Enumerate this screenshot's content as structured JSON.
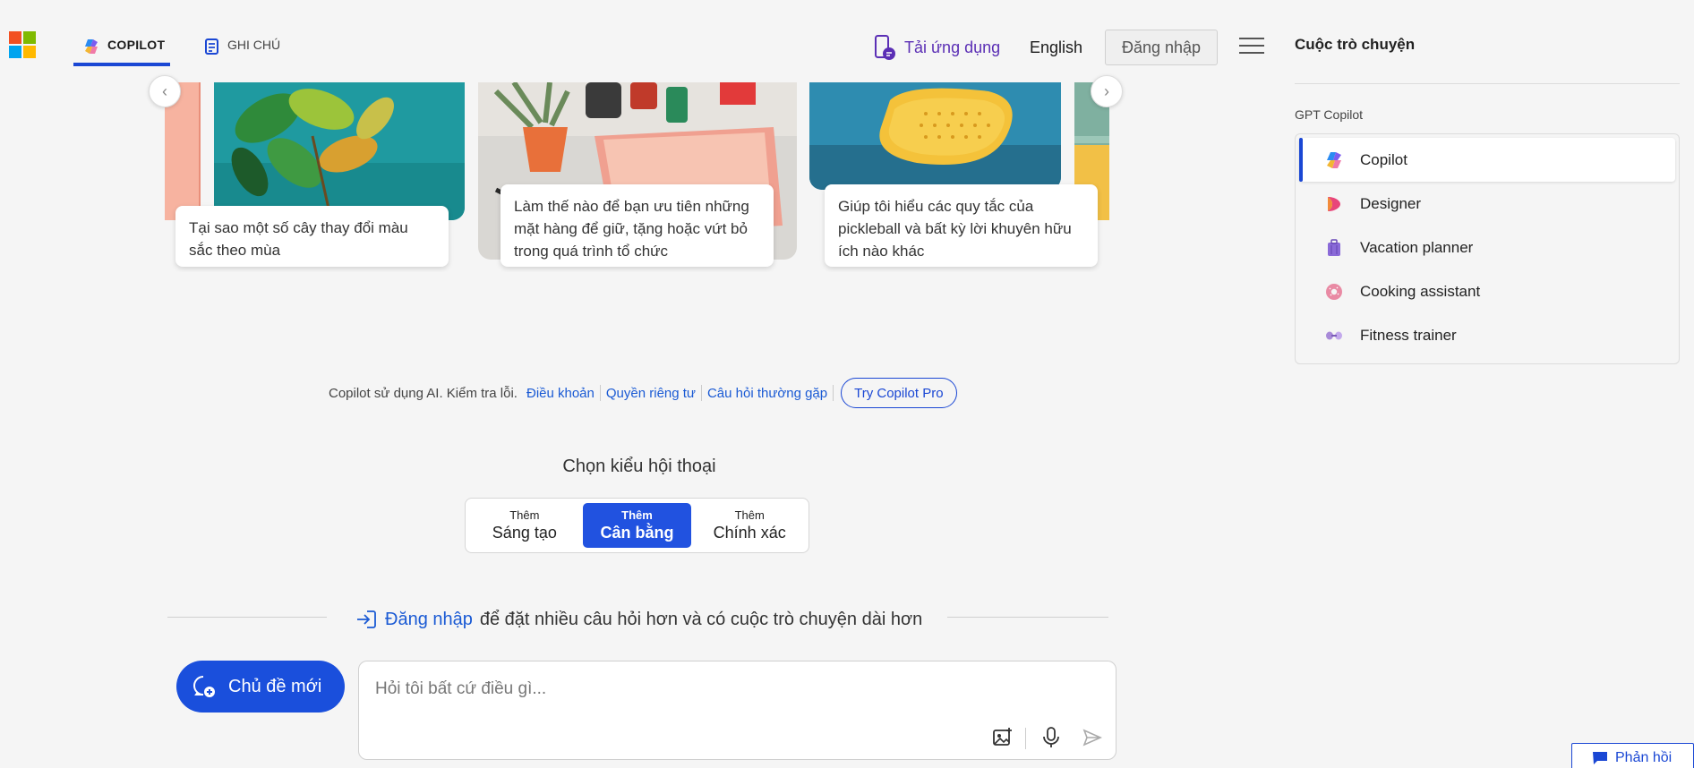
{
  "header": {
    "tabs": [
      {
        "label": "COPILOT",
        "icon": "copilot-icon",
        "active": true
      },
      {
        "label": "GHI CHÚ",
        "icon": "notes-icon",
        "active": false
      }
    ],
    "get_app": "Tải ứng dụng",
    "language": "English",
    "signin": "Đăng nhập"
  },
  "sidebar": {
    "title": "Cuộc trò chuyện",
    "section": "GPT Copilot",
    "items": [
      {
        "label": "Copilot",
        "icon": "copilot-icon",
        "active": true
      },
      {
        "label": "Designer",
        "icon": "designer-icon"
      },
      {
        "label": "Vacation planner",
        "icon": "suitcase-icon"
      },
      {
        "label": "Cooking assistant",
        "icon": "donut-icon"
      },
      {
        "label": "Fitness trainer",
        "icon": "dumbbell-icon"
      }
    ]
  },
  "carousel": {
    "cards": [
      {
        "caption": "Tại sao một số cây thay đổi màu sắc theo mùa"
      },
      {
        "caption": "Làm thế nào để bạn ưu tiên những mặt hàng để giữ, tặng hoặc vứt bỏ trong quá trình tổ chức"
      },
      {
        "caption": "Giúp tôi hiểu các quy tắc của pickleball và bất kỳ lời khuyên hữu ích nào khác"
      }
    ]
  },
  "legal": {
    "lead": "Copilot sử dụng AI. Kiểm tra lỗi.",
    "terms": "Điều khoản",
    "privacy": "Quyền riêng tư",
    "faq": "Câu hỏi thường gặp",
    "try_pro": "Try Copilot Pro"
  },
  "conversation_style": {
    "title": "Chọn kiểu hội thoại",
    "options": [
      {
        "small": "Thêm",
        "large": "Sáng tạo",
        "active": false
      },
      {
        "small": "Thêm",
        "large": "Cân bằng",
        "active": true
      },
      {
        "small": "Thêm",
        "large": "Chính xác",
        "active": false
      }
    ]
  },
  "signin_prompt": {
    "link": "Đăng nhập",
    "rest": "để đặt nhiều câu hỏi hơn và có cuộc trò chuyện dài hơn"
  },
  "composer": {
    "new_topic": "Chủ đề mới",
    "placeholder": "Hỏi tôi bất cứ điều gì..."
  },
  "feedback": "Phản hồi",
  "colors": {
    "accent": "#1a47d4",
    "background": "#f5f5f5",
    "app_link": "#5b2fb5"
  }
}
